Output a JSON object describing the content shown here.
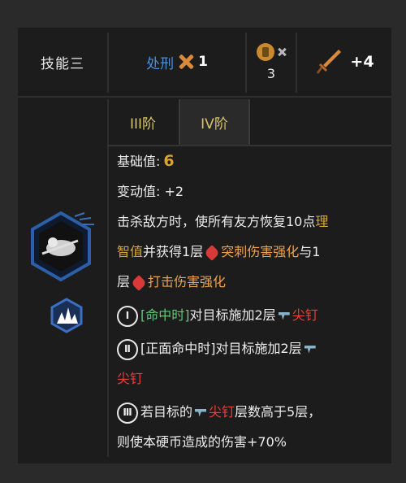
{
  "header": {
    "skill_title": "技能三",
    "execute_label": "处刑",
    "execute_count": "1",
    "coin_count": "3",
    "power_bonus": "+4"
  },
  "tabs": [
    {
      "label": "III阶",
      "active": false
    },
    {
      "label": "IV阶",
      "active": true
    }
  ],
  "stats": {
    "base_label": "基础值:",
    "base_value": "6",
    "variance_label": "变动值:",
    "variance_value": "+2"
  },
  "effect": {
    "line1_a": "击杀敌方时，使所有友方恢复10点",
    "line1_b": "理",
    "line2_a": "智值",
    "line2_b": "并获得1层",
    "line2_c": "突刺伤害强化",
    "line2_d": "与1",
    "line3_a": "层",
    "line3_b": "打击伤害强化",
    "coin1_roman": "Ⅰ",
    "coin1_trigger": "[命中时]",
    "coin1_text": "对目标施加2层",
    "coin1_status": "尖钉",
    "coin2_roman": "Ⅱ",
    "coin2_trigger": "[正面命中时]",
    "coin2_text": "对目标施加2层",
    "coin2_status": "尖钉",
    "coin3_roman": "Ⅲ",
    "coin3_text_a": "若目标的",
    "coin3_status": "尖钉",
    "coin3_text_b": "层数高于5层，",
    "coin3_text_c": "则使本硬币造成的伤害+70%"
  },
  "colors": {
    "gold": "#d9a431",
    "orange": "#f0a24a",
    "red": "#ef3c3c",
    "green": "#5fc97b",
    "blue": "#4a8fd9"
  },
  "icons": [
    "execute-x-icon",
    "coin-icon",
    "sword-icon",
    "heart-icon",
    "nail-icon",
    "spike-icon"
  ]
}
